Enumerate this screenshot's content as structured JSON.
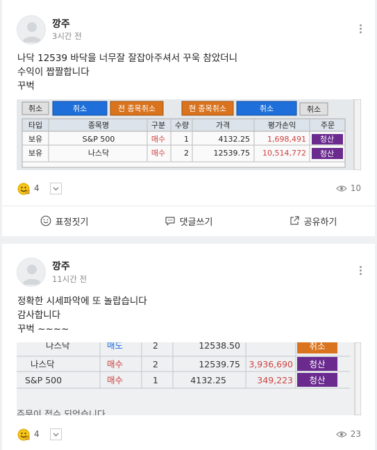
{
  "posts": [
    {
      "author": "깡주",
      "time": "3시간 전",
      "body": "나닥 12539 바닥을 너무잘 잘잡아주셔서 꾸욱 참았더니\n수익이 짭짤합니다\n 꾸벅",
      "reaction_count": "4",
      "view_count": "10",
      "actions": {
        "emotion": "표정짓기",
        "comment": "댓글쓰기",
        "share": "공유하기"
      },
      "screenshot": {
        "buttons": [
          "취소",
          "취소",
          "전 종목취소",
          "현 종목취소",
          "취소",
          "취소"
        ],
        "headers": [
          "타입",
          "종목명",
          "구분",
          "수량",
          "가격",
          "평가손익",
          "주문"
        ],
        "rows": [
          {
            "type": "보유",
            "name": "S&P 500",
            "side": "매수",
            "qty": "1",
            "price": "4132.25",
            "pnl": "1,698,491",
            "order": "청산"
          },
          {
            "type": "보유",
            "name": "나스닥",
            "side": "매수",
            "qty": "2",
            "price": "12539.75",
            "pnl": "10,514,772",
            "order": "청산"
          }
        ]
      }
    },
    {
      "author": "깡주",
      "time": "11시간 전",
      "body": "정확한 시세파악에 또 놀랍습니다\n감사합니다\n꾸벅 ~~~~",
      "reaction_count": "4",
      "view_count": "23",
      "screenshot": {
        "rows": [
          {
            "name": "나스닥",
            "side": "매도",
            "qty": "2",
            "price": "12538.50",
            "pnl": "",
            "order": "취소"
          },
          {
            "name": "나스닥",
            "side": "매수",
            "qty": "2",
            "price": "12539.75",
            "pnl": "3,936,690",
            "order": "청산"
          },
          {
            "name": "S&P 500",
            "side": "매수",
            "qty": "1",
            "price": "4132.25",
            "pnl": "349,223",
            "order": "청산"
          }
        ],
        "footer": "주문이 접수 되었습니다"
      }
    }
  ],
  "colors": {
    "accent_blue": "#1e6fd9",
    "order_orange": "#d9731e",
    "liquidate_purple": "#6a2a8e",
    "sell_red": "#d04040"
  }
}
